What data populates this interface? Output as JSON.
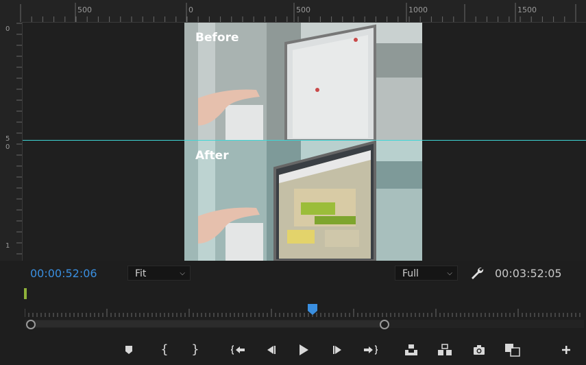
{
  "ruler": {
    "h_labels": [
      "500",
      "0",
      "500",
      "1000",
      "1500"
    ],
    "v_labels": [
      "0",
      "5",
      "0",
      "1"
    ]
  },
  "frames": {
    "before_label": "Before",
    "after_label": "After"
  },
  "playback": {
    "current_timecode": "00:00:52:06",
    "duration_timecode": "00:03:52:05",
    "zoom_select": "Fit",
    "quality_select": "Full"
  },
  "colors": {
    "timecode_accent": "#3a8fe0",
    "guide_line": "#3fd6d6",
    "in_marker": "#8fb23a",
    "playhead": "#3a8fe0"
  },
  "toolbar_icons": [
    "add-marker-icon",
    "mark-in-icon",
    "mark-out-icon",
    "go-to-in-icon",
    "step-back-icon",
    "play-icon",
    "step-forward-icon",
    "go-to-out-icon",
    "lift-icon",
    "extract-icon",
    "export-frame-icon",
    "comparison-view-icon",
    "add-button-icon"
  ]
}
